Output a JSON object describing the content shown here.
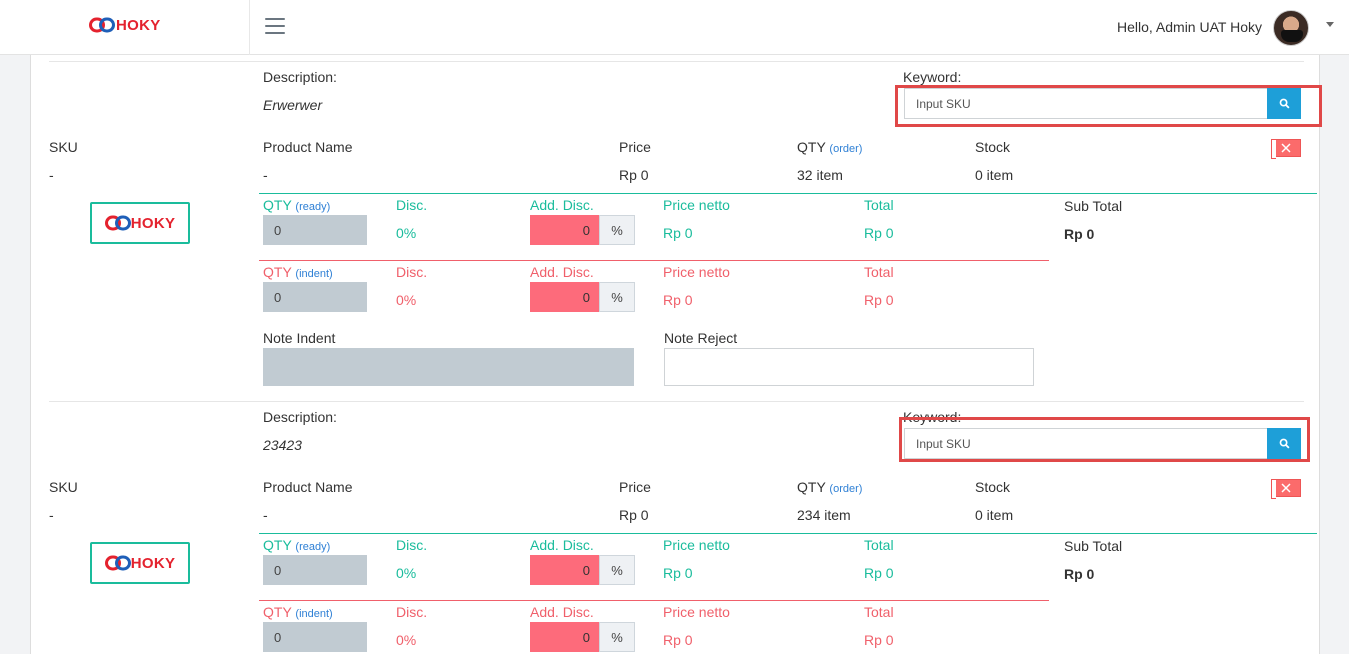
{
  "header": {
    "brand": "HOKY",
    "greeting": "Hello, Admin UAT Hoky"
  },
  "items": [
    {
      "description_label": "Description:",
      "description_value": "Erwerwer",
      "keyword_label": "Keyword:",
      "keyword_placeholder": "Input SKU",
      "sku_label": "SKU",
      "sku_value": "-",
      "product_name_label": "Product Name",
      "product_name_value": "-",
      "price_label": "Price",
      "price_value": "Rp 0",
      "qty_label": "QTY",
      "qty_order_tag": "(order)",
      "qty_value": "32 item",
      "stock_label": "Stock",
      "stock_value": "0 item",
      "brand_card": "HOKY",
      "ready": {
        "qty_label": "QTY",
        "qty_tag": "(ready)",
        "qty_value": "0",
        "disc_label": "Disc.",
        "disc_value": "0%",
        "add_disc_label": "Add. Disc.",
        "add_disc_value": "0",
        "pct": "%",
        "price_netto_label": "Price netto",
        "price_netto_value": "Rp 0",
        "total_label": "Total",
        "total_value": "Rp 0"
      },
      "indent": {
        "qty_label": "QTY",
        "qty_tag": "(indent)",
        "qty_value": "0",
        "disc_label": "Disc.",
        "disc_value": "0%",
        "add_disc_label": "Add. Disc.",
        "add_disc_value": "0",
        "pct": "%",
        "price_netto_label": "Price netto",
        "price_netto_value": "Rp 0",
        "total_label": "Total",
        "total_value": "Rp 0"
      },
      "subtotal_label": "Sub Total",
      "subtotal_value": "Rp 0",
      "note_indent_label": "Note Indent",
      "note_reject_label": "Note Reject"
    },
    {
      "description_label": "Description:",
      "description_value": "23423",
      "keyword_label": "Keyword:",
      "keyword_placeholder": "Input SKU",
      "sku_label": "SKU",
      "sku_value": "-",
      "product_name_label": "Product Name",
      "product_name_value": "-",
      "price_label": "Price",
      "price_value": "Rp 0",
      "qty_label": "QTY",
      "qty_order_tag": "(order)",
      "qty_value": "234 item",
      "stock_label": "Stock",
      "stock_value": "0 item",
      "brand_card": "HOKY",
      "ready": {
        "qty_label": "QTY",
        "qty_tag": "(ready)",
        "qty_value": "0",
        "disc_label": "Disc.",
        "disc_value": "0%",
        "add_disc_label": "Add. Disc.",
        "add_disc_value": "0",
        "pct": "%",
        "price_netto_label": "Price netto",
        "price_netto_value": "Rp 0",
        "total_label": "Total",
        "total_value": "Rp 0"
      },
      "indent": {
        "qty_label": "QTY",
        "qty_tag": "(indent)",
        "qty_value": "0",
        "disc_label": "Disc.",
        "disc_value": "0%",
        "add_disc_label": "Add. Disc.",
        "add_disc_value": "0",
        "pct": "%",
        "price_netto_label": "Price netto",
        "price_netto_value": "Rp 0",
        "total_label": "Total",
        "total_value": "Rp 0"
      },
      "subtotal_label": "Sub Total",
      "subtotal_value": "Rp 0"
    }
  ],
  "colors": {
    "teal": "#1abc9c",
    "red": "#f0606b",
    "search_button": "#1e9fd8",
    "highlight_frame": "#e04848"
  },
  "icons": {
    "menu": "hamburger-icon",
    "search": "search-icon",
    "remove": "close-icon",
    "brand": "hoky-logo-icon",
    "dropdown": "chevron-down-icon"
  }
}
